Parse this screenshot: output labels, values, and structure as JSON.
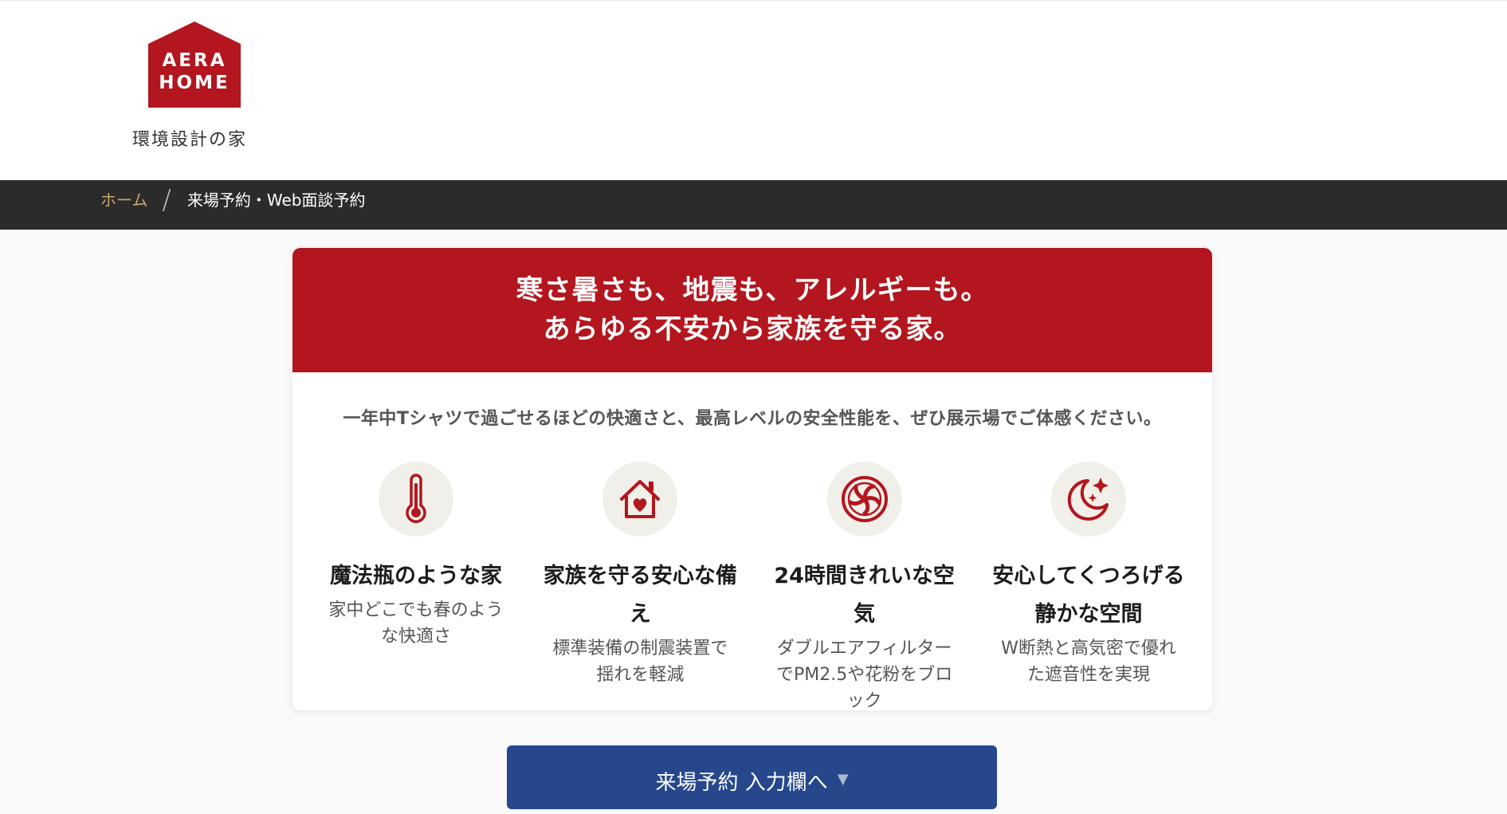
{
  "header": {
    "logo": {
      "line1": "AERA",
      "line2": "HOME",
      "caption": "環境設計の家",
      "icon": "house-logo-icon"
    }
  },
  "breadcrumb": {
    "home": "ホーム",
    "separator": "/",
    "current": "来場予約・Web面談予約"
  },
  "hero": {
    "headline_line1": "寒さ暑さも、地震も、アレルギーも。",
    "headline_line2": "あらゆる不安から家族を守る家。",
    "intro": "一年中Tシャツで過ごせるほどの快適さと、最高レベルの安全性能を、ぜひ展示場でご体感ください。"
  },
  "features": [
    {
      "icon": "thermometer-icon",
      "title": "魔法瓶のような家",
      "desc": "家中どこでも春のような快適さ"
    },
    {
      "icon": "house-heart-icon",
      "title": "家族を守る安心な備え",
      "desc": "標準装備の制震装置で揺れを軽減"
    },
    {
      "icon": "fan-filter-icon",
      "title": "24時間きれいな空気",
      "desc": "ダブルエアフィルターでPM2.5や花粉をブロック"
    },
    {
      "icon": "moon-stars-icon",
      "title": "安心してくつろげる静かな空間",
      "desc": "W断熱と高気密で優れた遮音性を実現"
    }
  ],
  "cta": {
    "label": "来場予約 入力欄へ",
    "arrow": "▼"
  },
  "colors": {
    "brand_red": "#b3161e",
    "breadcrumb_bg": "#2b2b2b",
    "breadcrumb_link": "#c9a86a",
    "cta_blue": "#26478b",
    "icon_bg": "#f1efe9"
  }
}
